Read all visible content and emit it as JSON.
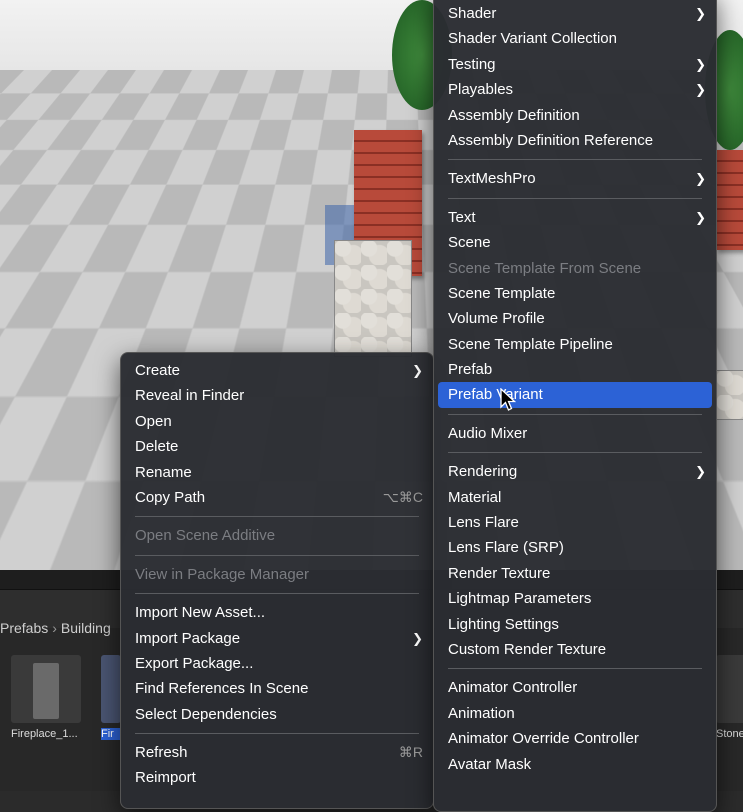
{
  "breadcrumb": {
    "items": [
      "Prefabs",
      "Building"
    ]
  },
  "assets": [
    {
      "label": "Fireplace_1..."
    },
    {
      "label": "Fir"
    },
    {
      "label": "Stone"
    }
  ],
  "left_menu": {
    "create": "Create",
    "reveal": "Reveal in Finder",
    "open": "Open",
    "delete": "Delete",
    "rename": "Rename",
    "copy_path": "Copy Path",
    "copy_path_shortcut": "⌥⌘C",
    "open_scene_additive": "Open Scene Additive",
    "view_package_manager": "View in Package Manager",
    "import_new_asset": "Import New Asset...",
    "import_package": "Import Package",
    "export_package": "Export Package...",
    "find_references": "Find References In Scene",
    "select_dependencies": "Select Dependencies",
    "refresh": "Refresh",
    "refresh_shortcut": "⌘R",
    "reimport": "Reimport"
  },
  "right_menu": {
    "shader": "Shader",
    "shader_variant_collection": "Shader Variant Collection",
    "testing": "Testing",
    "playables": "Playables",
    "assembly_definition": "Assembly Definition",
    "assembly_definition_reference": "Assembly Definition Reference",
    "textmeshpro": "TextMeshPro",
    "text": "Text",
    "scene": "Scene",
    "scene_template_from_scene": "Scene Template From Scene",
    "scene_template": "Scene Template",
    "volume_profile": "Volume Profile",
    "scene_template_pipeline": "Scene Template Pipeline",
    "prefab": "Prefab",
    "prefab_variant": "Prefab Variant",
    "audio_mixer": "Audio Mixer",
    "rendering": "Rendering",
    "material": "Material",
    "lens_flare": "Lens Flare",
    "lens_flare_srp": "Lens Flare (SRP)",
    "render_texture": "Render Texture",
    "lightmap_parameters": "Lightmap Parameters",
    "lighting_settings": "Lighting Settings",
    "custom_render_texture": "Custom Render Texture",
    "animator_controller": "Animator Controller",
    "animation": "Animation",
    "animator_override_controller": "Animator Override Controller",
    "avatar_mask": "Avatar Mask"
  },
  "colors": {
    "highlight": "#2c62d6",
    "menu_bg": "#2a2c32",
    "disabled_text": "#7b7d82"
  }
}
